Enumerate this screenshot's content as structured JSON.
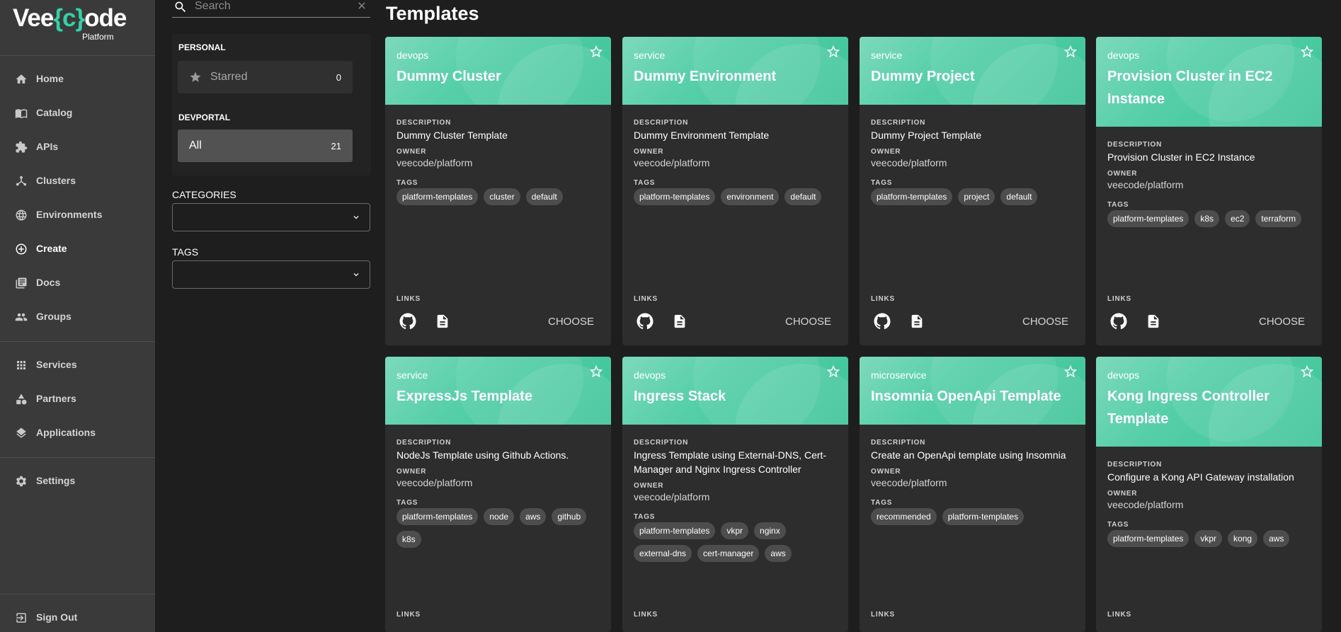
{
  "brand": {
    "logo_left": "Vee",
    "logo_brace": "{c}",
    "logo_right": "ode",
    "logo_sub": "Platform"
  },
  "sidebar": {
    "items": [
      {
        "label": "Home",
        "icon": "home-icon"
      },
      {
        "label": "Catalog",
        "icon": "catalog-icon"
      },
      {
        "label": "APIs",
        "icon": "puzzle-icon"
      },
      {
        "label": "Clusters",
        "icon": "cluster-icon"
      },
      {
        "label": "Environments",
        "icon": "globe-icon"
      },
      {
        "label": "Create",
        "icon": "add-circle-icon",
        "active": true
      },
      {
        "label": "Docs",
        "icon": "docs-icon"
      },
      {
        "label": "Groups",
        "icon": "groups-icon"
      },
      {
        "label": "Services",
        "icon": "apps-grid-icon"
      },
      {
        "label": "Partners",
        "icon": "shapes-icon"
      },
      {
        "label": "Applications",
        "icon": "layers-icon"
      },
      {
        "label": "Settings",
        "icon": "gear-icon"
      },
      {
        "label": "Sign Out",
        "icon": "sign-out-icon"
      }
    ]
  },
  "filters": {
    "search_placeholder": "Search",
    "personal_heading": "PERSONAL",
    "starred_label": "Starred",
    "starred_count": "0",
    "devportal_heading": "DEVPORTAL",
    "all_label": "All",
    "all_count": "21",
    "categories_label": "CATEGORIES",
    "tags_label": "TAGS"
  },
  "main": {
    "title": "Templates",
    "labels": {
      "description": "DESCRIPTION",
      "owner": "OWNER",
      "tags": "TAGS",
      "links": "LINKS",
      "choose": "CHOOSE"
    },
    "cards": [
      {
        "type": "devops",
        "title": "Dummy Cluster",
        "description": "Dummy Cluster Template",
        "owner": "veecode/platform",
        "tags": [
          "platform-templates",
          "cluster",
          "default"
        ]
      },
      {
        "type": "service",
        "title": "Dummy Environment",
        "description": "Dummy Environment Template",
        "owner": "veecode/platform",
        "tags": [
          "platform-templates",
          "environment",
          "default"
        ]
      },
      {
        "type": "service",
        "title": "Dummy Project",
        "description": "Dummy Project Template",
        "owner": "veecode/platform",
        "tags": [
          "platform-templates",
          "project",
          "default"
        ]
      },
      {
        "type": "devops",
        "title": "Provision Cluster in EC2 Instance",
        "description": "Provision Cluster in EC2 Instance",
        "owner": "veecode/platform",
        "tags": [
          "platform-templates",
          "k8s",
          "ec2",
          "terraform"
        ]
      },
      {
        "type": "service",
        "title": "ExpressJs Template",
        "description": "NodeJs Template using Github Actions.",
        "owner": "veecode/platform",
        "tags": [
          "platform-templates",
          "node",
          "aws",
          "github",
          "k8s"
        ]
      },
      {
        "type": "devops",
        "title": "Ingress Stack",
        "description": "Ingress Template using External-DNS, Cert-Manager and Nginx Ingress Controller",
        "owner": "veecode/platform",
        "tags": [
          "platform-templates",
          "vkpr",
          "nginx",
          "external-dns",
          "cert-manager",
          "aws"
        ]
      },
      {
        "type": "microservice",
        "title": "Insomnia OpenApi Template",
        "description": "Create an OpenApi template using Insomnia",
        "owner": "veecode/platform",
        "tags": [
          "recommended",
          "platform-templates"
        ]
      },
      {
        "type": "devops",
        "title": "Kong Ingress Controller Template",
        "description": "Configure a Kong API Gateway installation",
        "owner": "veecode/platform",
        "tags": [
          "platform-templates",
          "vkpr",
          "kong",
          "aws"
        ]
      }
    ]
  },
  "colors": {
    "accent": "#3cc498",
    "sidebar_bg": "#3a3a3a",
    "card_bg": "#2d2d2d",
    "page_bg": "#1e1e1e"
  }
}
